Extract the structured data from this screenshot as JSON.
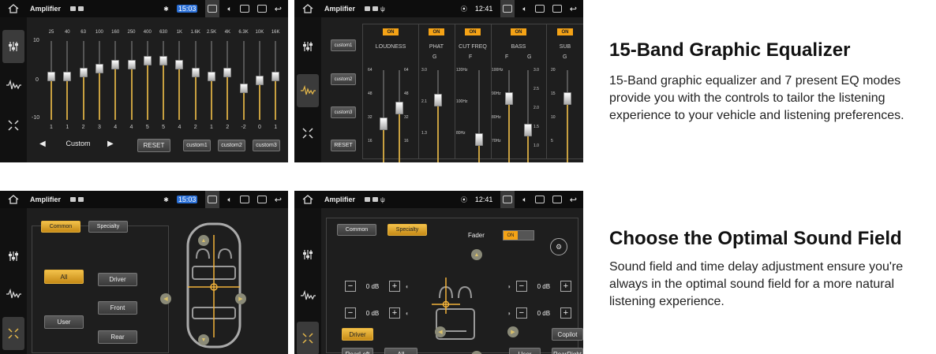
{
  "panels": {
    "p1": {
      "app_title": "Amplifier",
      "time": "15:03",
      "db_labels": [
        "10",
        "0",
        "-10"
      ],
      "freqs": [
        "25",
        "40",
        "63",
        "100",
        "160",
        "250",
        "400",
        "630",
        "1K",
        "1.6K",
        "2.5K",
        "4K",
        "6.3K",
        "10K",
        "16K"
      ],
      "values": [
        "1",
        "1",
        "2",
        "3",
        "4",
        "4",
        "5",
        "5",
        "4",
        "2",
        "1",
        "2",
        "-2",
        "0",
        "1"
      ],
      "preset_name": "Custom",
      "reset_label": "RESET",
      "custom_buttons": [
        "custom1",
        "custom2",
        "custom3"
      ]
    },
    "p2": {
      "app_title": "Amplifier",
      "time": "12:41",
      "custom_buttons": [
        "custom1",
        "custom2",
        "custom3"
      ],
      "reset_label": "RESET",
      "on_label": "ON",
      "sections": [
        "LOUDNESS",
        "PHAT",
        "CUT FREQ",
        "BASS",
        "SUB"
      ],
      "g_label": "G",
      "f_label": "F",
      "loudness_scale": [
        "64",
        "48",
        "32",
        "16",
        "0"
      ],
      "phat_scale": [
        "3.0",
        "2.1",
        "1.3",
        "0.5"
      ],
      "cut_scale": [
        "120Hz",
        "100Hz",
        "80Hz",
        "60Hz"
      ],
      "bass_f_scale": [
        "100Hz",
        "90Hz",
        "80Hz",
        "70Hz",
        "60Hz"
      ],
      "bass_g_scale": [
        "3.0",
        "2.5",
        "2.0",
        "1.5",
        "1.0",
        "0.5"
      ],
      "sub_scale": [
        "20",
        "15",
        "10",
        "5",
        "0"
      ]
    },
    "p3": {
      "app_title": "Amplifier",
      "time": "15:03",
      "tab_common": "Common",
      "tab_specialty": "Specialty",
      "all_label": "All",
      "user_label": "User",
      "driver_label": "Driver",
      "front_label": "Front",
      "rear_label": "Rear"
    },
    "p4": {
      "app_title": "Amplifier",
      "time": "12:41",
      "tab_common": "Common",
      "tab_specialty": "Specialty",
      "fader_label": "Fader",
      "fader_on": "ON",
      "db_values": [
        "0 dB",
        "0 dB",
        "0 dB",
        "0 dB"
      ],
      "driver_label": "Driver",
      "copilot_label": "Copilot",
      "rearleft_label": "RearLeft",
      "all_label": "All",
      "user_label": "User",
      "rearright_label": "RearRight"
    }
  },
  "features": [
    {
      "title": "15-Band Graphic Equalizer",
      "lines": [
        "15-Band graphic equalizer and 7 present EQ modes",
        "provide you with the controls to tailor the listening",
        "experience to your vehicle and listening preferences."
      ]
    },
    {
      "title": "Choose the Optimal Sound Field",
      "lines": [
        "Sound field and time delay adjustment ensure you're",
        "always in the optimal sound field for a more natural",
        "listening experience."
      ]
    }
  ],
  "colors": {
    "accent": "#f2b23a",
    "panel_bg": "#1e1e1e",
    "track": "#c8a040"
  },
  "eq_levels": [
    1,
    1,
    2,
    3,
    4,
    4,
    5,
    5,
    4,
    2,
    1,
    2,
    -2,
    0,
    1
  ]
}
